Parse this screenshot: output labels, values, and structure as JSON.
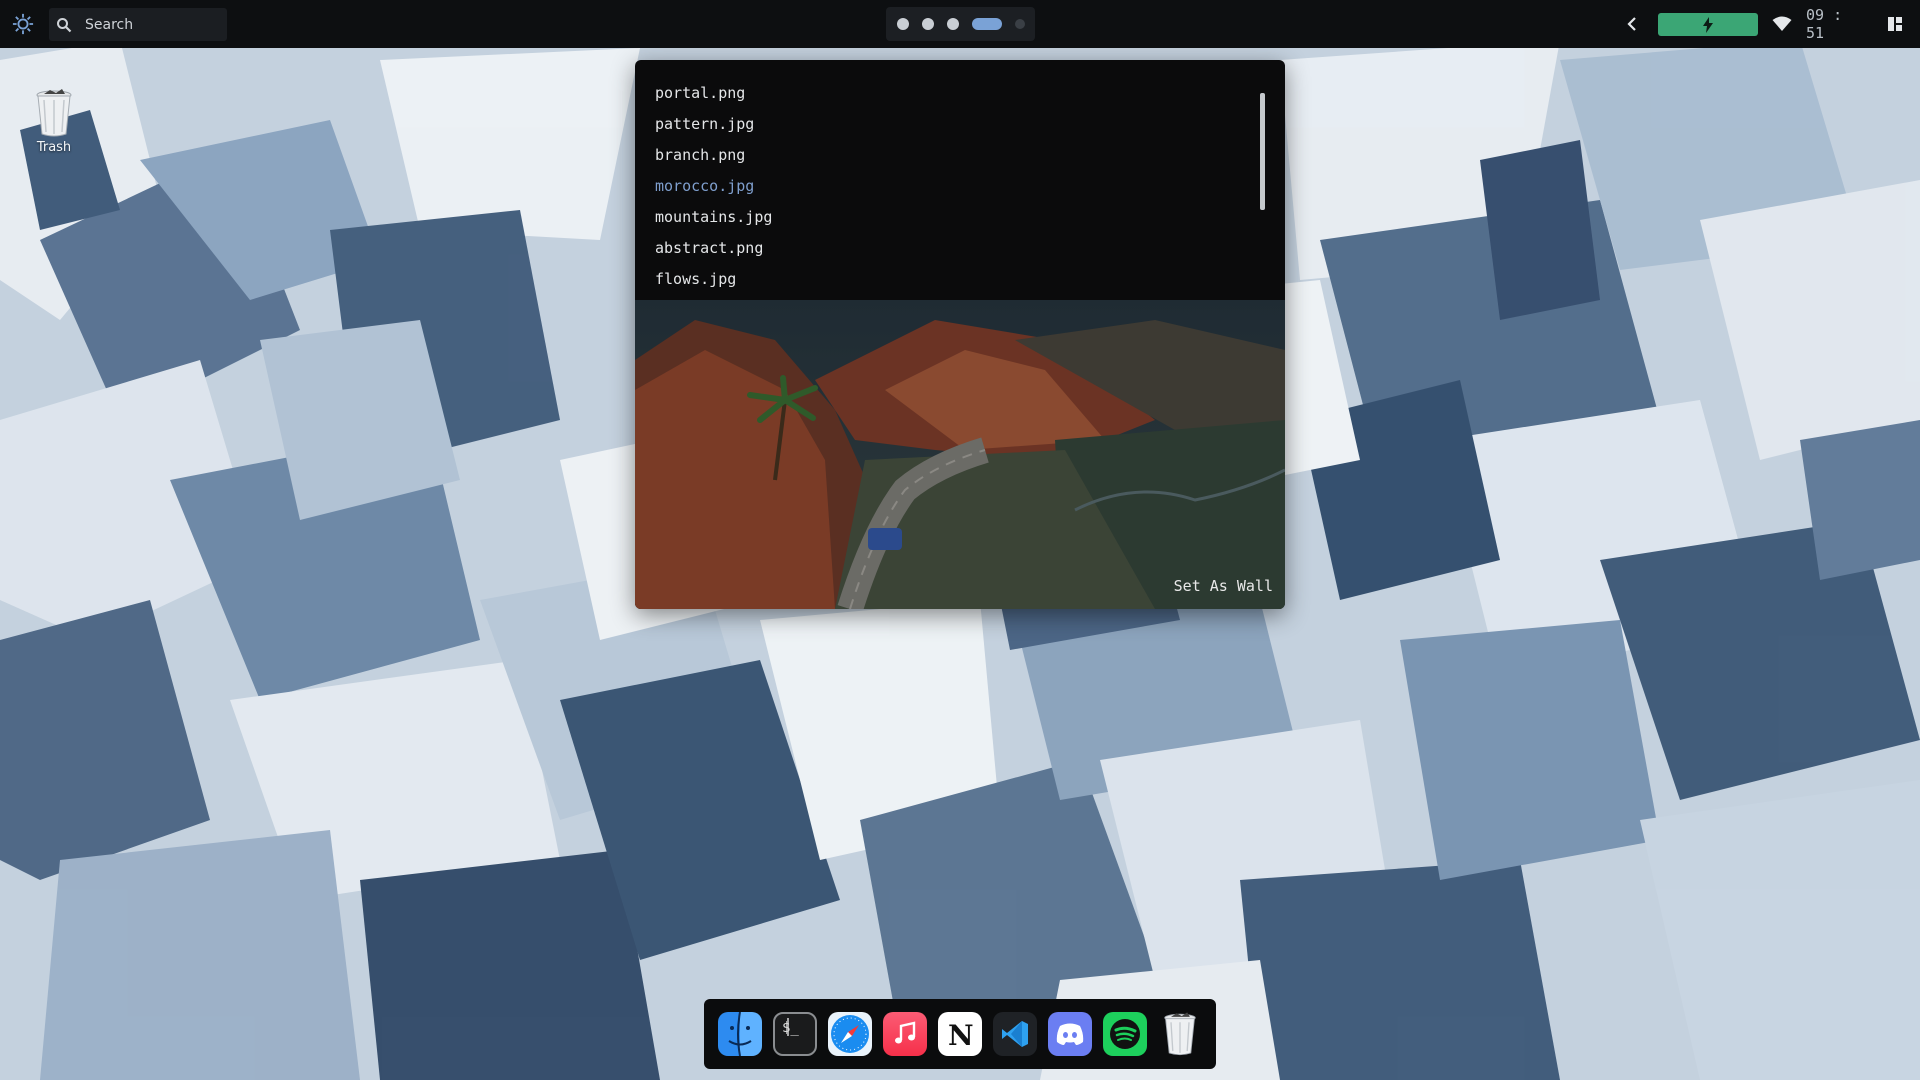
{
  "topbar": {
    "search_placeholder": "Search",
    "clock": "09 : 51",
    "workspaces": [
      "1",
      "2",
      "3",
      "4",
      "5"
    ],
    "active_workspace": "4",
    "battery": {
      "charging": true,
      "color": "#3ba675"
    },
    "accent": "#7aa2d6",
    "icons": [
      "gear-icon",
      "search-icon",
      "chevron-left-icon",
      "lightning-icon",
      "wifi-icon",
      "layout-icon"
    ]
  },
  "desktop": {
    "trash_label": "Trash"
  },
  "picker": {
    "files": [
      "portal.png",
      "pattern.jpg",
      "branch.png",
      "morocco.jpg",
      "mountains.jpg",
      "abstract.png",
      "flows.jpg"
    ],
    "selected": "morocco.jpg",
    "selected_color": "#7f9fce",
    "action_label": "Set As Wall"
  },
  "dock": {
    "apps": [
      "finder-icon",
      "terminal-icon",
      "safari-icon",
      "music-icon",
      "notion-icon",
      "vscode-icon",
      "discord-icon",
      "spotify-icon",
      "trash-icon"
    ]
  }
}
